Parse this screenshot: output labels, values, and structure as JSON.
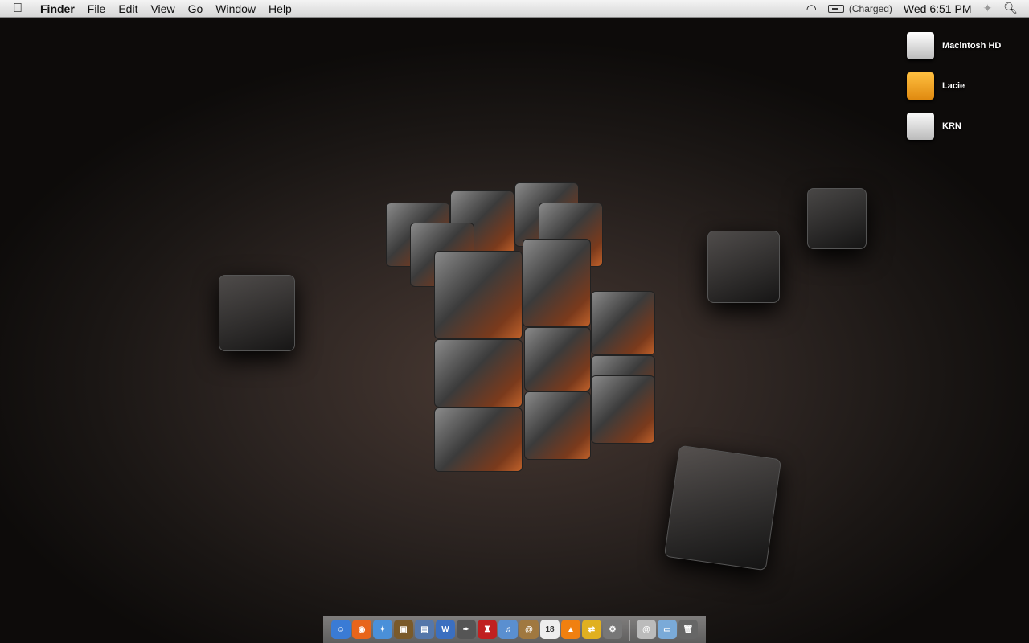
{
  "menubar": {
    "app": "Finder",
    "items": [
      "File",
      "Edit",
      "View",
      "Go",
      "Window",
      "Help"
    ],
    "battery_status": "(Charged)",
    "clock": "Wed 6:51 PM"
  },
  "desktop_icons": [
    {
      "label": "Macintosh HD",
      "color": "#e8e8e8"
    },
    {
      "label": "Lacie",
      "color": "#f0a020"
    },
    {
      "label": "KRN",
      "color": "#e0e0e0"
    }
  ],
  "dock": {
    "apps": [
      {
        "name": "finder",
        "color": "#3a7bd5",
        "glyph": "☺"
      },
      {
        "name": "firefox",
        "color": "#e8651a",
        "glyph": "◉"
      },
      {
        "name": "safari",
        "color": "#4a90d9",
        "glyph": "✦"
      },
      {
        "name": "iphoto",
        "color": "#7a5a2a",
        "glyph": "▣"
      },
      {
        "name": "preview",
        "color": "#5577aa",
        "glyph": "▤"
      },
      {
        "name": "word",
        "color": "#3b6fc0",
        "glyph": "W"
      },
      {
        "name": "quill-app",
        "color": "#555",
        "glyph": "✒"
      },
      {
        "name": "red-app",
        "color": "#c02020",
        "glyph": "♜"
      },
      {
        "name": "itunes",
        "color": "#5a8fd0",
        "glyph": "♫"
      },
      {
        "name": "address-book",
        "color": "#a07840",
        "glyph": "@"
      },
      {
        "name": "ical",
        "color": "#eeeeee",
        "glyph": "18"
      },
      {
        "name": "vlc",
        "color": "#f08010",
        "glyph": "▲"
      },
      {
        "name": "parallels",
        "color": "#e0b020",
        "glyph": "⇄"
      },
      {
        "name": "system-preferences",
        "color": "#777",
        "glyph": "⚙"
      }
    ],
    "stacks": [
      {
        "name": "downloads-stack",
        "color": "#bbb",
        "glyph": "@"
      },
      {
        "name": "documents-folder",
        "color": "#7aaad8",
        "glyph": "▭"
      },
      {
        "name": "trash",
        "color": "#666",
        "glyph": "🗑"
      }
    ]
  }
}
